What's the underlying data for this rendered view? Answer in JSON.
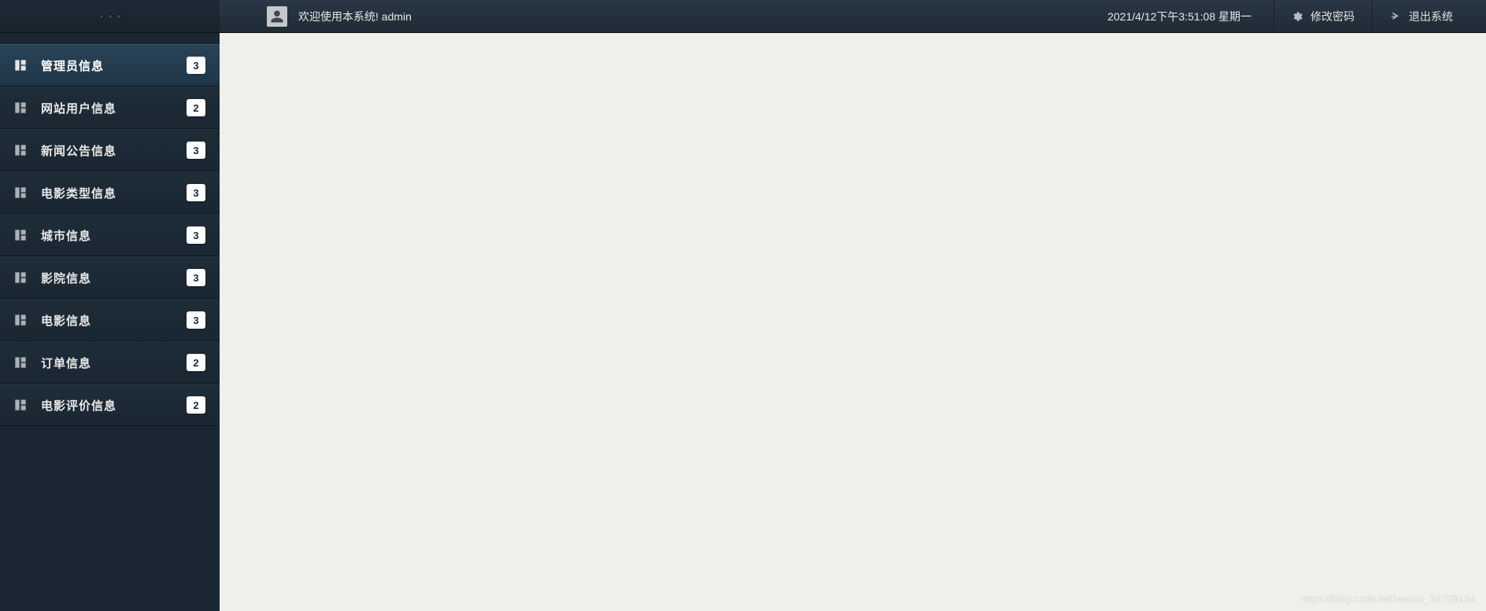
{
  "header": {
    "welcome_text": "欢迎使用本系统! admin",
    "datetime": "2021/4/12下午3:51:08 星期一",
    "change_password_label": "修改密码",
    "logout_label": "退出系统"
  },
  "sidebar": {
    "items": [
      {
        "label": "管理员信息",
        "badge": "3",
        "active": true
      },
      {
        "label": "网站用户信息",
        "badge": "2",
        "active": false
      },
      {
        "label": "新闻公告信息",
        "badge": "3",
        "active": false
      },
      {
        "label": "电影类型信息",
        "badge": "3",
        "active": false
      },
      {
        "label": "城市信息",
        "badge": "3",
        "active": false
      },
      {
        "label": "影院信息",
        "badge": "3",
        "active": false
      },
      {
        "label": "电影信息",
        "badge": "3",
        "active": false
      },
      {
        "label": "订单信息",
        "badge": "2",
        "active": false
      },
      {
        "label": "电影评价信息",
        "badge": "2",
        "active": false
      }
    ]
  },
  "watermark": "https://blog.csdn.net/weixin_39709134"
}
